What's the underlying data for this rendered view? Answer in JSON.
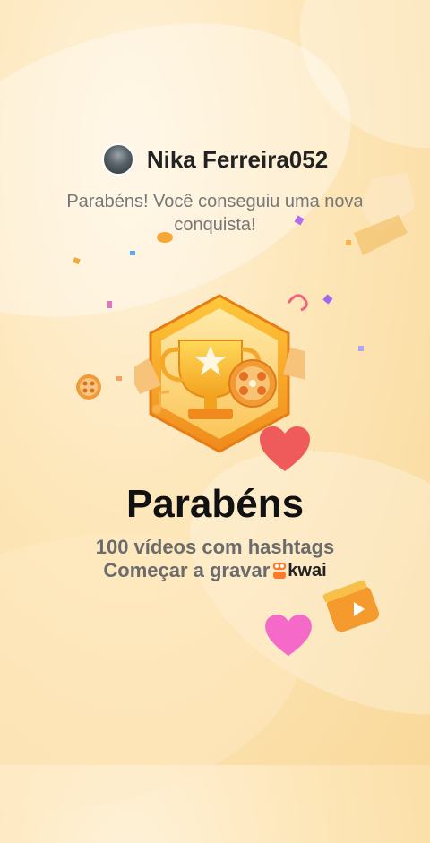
{
  "user": {
    "name": "Nika Ferreira052"
  },
  "message": "Parabéns! Você conseguiu uma nova conquista!",
  "achievement": {
    "title": "Parabéns",
    "description": "100 vídeos com hashtags",
    "action": "Começar a gravar"
  },
  "branding": {
    "logo": "kwai"
  },
  "colors": {
    "badge": "#f3a524",
    "heart_red": "#ef5b5b",
    "heart_pink": "#f56ac9"
  }
}
